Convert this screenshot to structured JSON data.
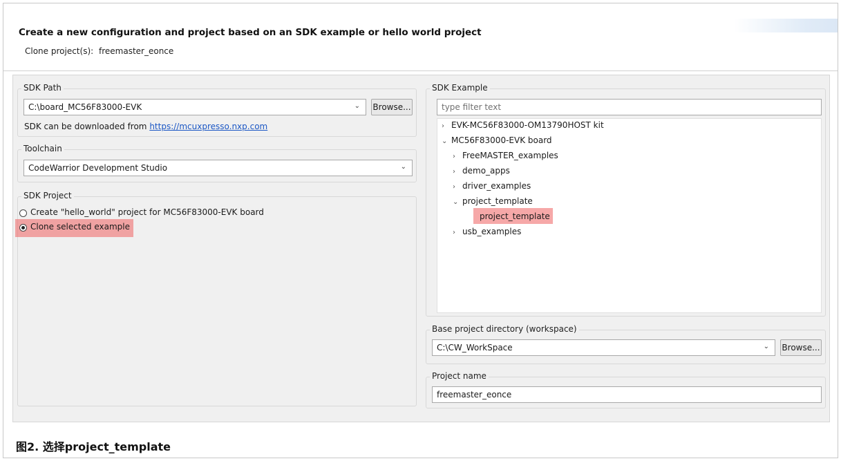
{
  "header": {
    "title": "Create a new configuration and project based on an SDK example or hello world project",
    "clone_label": "Clone project(s):",
    "clone_value": "freemaster_eonce"
  },
  "sdk_path": {
    "group_label": "SDK Path",
    "value": "C:\\board_MC56F83000-EVK",
    "browse_label": "Browse...",
    "download_text": "SDK can be downloaded from",
    "download_link": "https://mcuxpresso.nxp.com"
  },
  "toolchain": {
    "group_label": "Toolchain",
    "value": "CodeWarrior Development Studio"
  },
  "sdk_project": {
    "group_label": "SDK Project",
    "options": [
      {
        "label": "Create \"hello_world\" project for MC56F83000-EVK board",
        "selected": false
      },
      {
        "label": "Clone selected example",
        "selected": true
      }
    ]
  },
  "sdk_example": {
    "group_label": "SDK Example",
    "filter_placeholder": "type filter text",
    "tree": [
      {
        "label": "EVK-MC56F83000-OM13790HOST kit",
        "toggle": ">"
      },
      {
        "label": "MC56F83000-EVK board",
        "toggle": "v"
      },
      {
        "label": "FreeMASTER_examples",
        "toggle": ">"
      },
      {
        "label": "demo_apps",
        "toggle": ">"
      },
      {
        "label": "driver_examples",
        "toggle": ">"
      },
      {
        "label": "project_template",
        "toggle": "v"
      },
      {
        "label": "project_template",
        "toggle": ""
      },
      {
        "label": "usb_examples",
        "toggle": ">"
      }
    ]
  },
  "base_dir": {
    "group_label": "Base project directory (workspace)",
    "value": "C:\\CW_WorkSpace",
    "browse_label": "Browse..."
  },
  "project_name": {
    "group_label": "Project name",
    "value": "freemaster_eonce"
  },
  "caption": "图2. 选择project_template",
  "colors": {
    "highlight": "#f07070",
    "link": "#1a56c4"
  },
  "icons": {
    "dropdown": "chevron-down-icon",
    "expand": "chevron-right-icon",
    "collapse": "chevron-down-icon"
  }
}
